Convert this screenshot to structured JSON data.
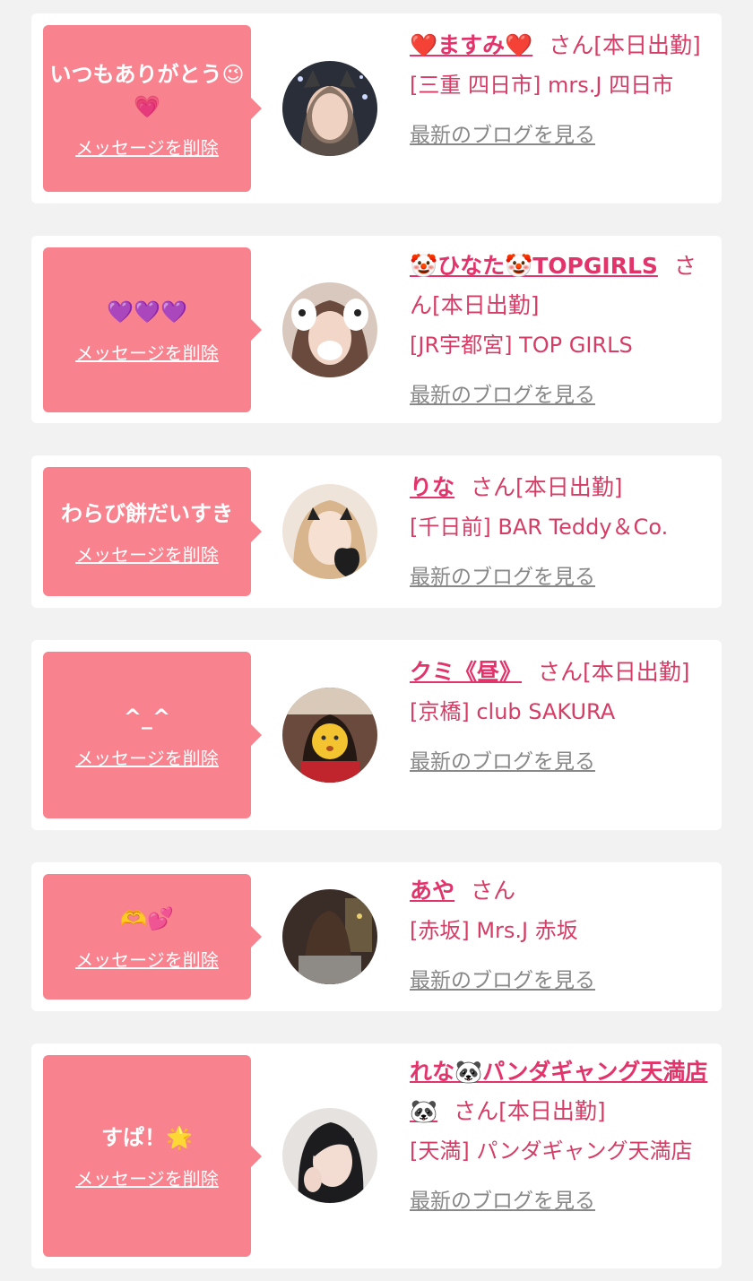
{
  "delete_label": "メッセージを削除",
  "blog_label": "最新のブログを見る",
  "honorific": "さん",
  "messages": [
    {
      "message": "いつもありがとう😉💗",
      "name": "❤️ますみ❤️",
      "status": "[本日出勤]",
      "shop": "[三重 四日市] mrs.J 四日市"
    },
    {
      "message": "💜💜💜",
      "name": "🤡ひなた🤡TOPGIRLS",
      "status": "[本日出勤]",
      "shop": "[JR宇都宮] TOP GIRLS"
    },
    {
      "message": "わらび餅だいすき",
      "name": "りな",
      "status": "[本日出勤]",
      "shop": "[千日前] BAR Teddy＆Co."
    },
    {
      "message": "^_^",
      "name": "クミ《昼》",
      "status": "[本日出勤]",
      "shop": "[京橋] club SAKURA"
    },
    {
      "message": "🫶💕",
      "name": "あや",
      "status": "",
      "shop": "[赤坂] Mrs.J 赤坂"
    },
    {
      "message": "すぱ！🌟",
      "name": "れな🐼パンダギャング天満店🐼",
      "status": "[本日出勤]",
      "shop": "[天満] パンダギャング天満店"
    }
  ],
  "colors": {
    "bubble": "#f8838f",
    "name": "#e2336b",
    "text": "#d63d66",
    "blog_link": "#888888",
    "background": "#f2f2f2"
  }
}
